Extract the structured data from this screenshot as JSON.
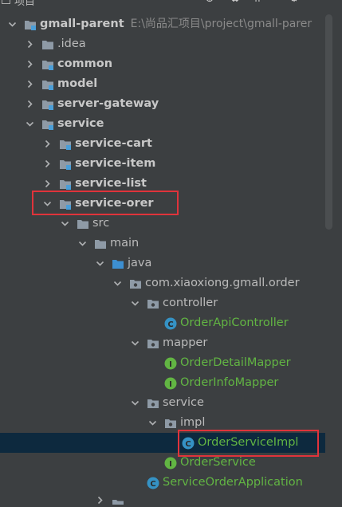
{
  "header": {
    "title": "项目"
  },
  "tree": {
    "rows": [
      {
        "label": "gmall-parent",
        "path": "E:\\尚品汇项目\\project\\gmall-parer"
      },
      {
        "label": ".idea"
      },
      {
        "label": "common"
      },
      {
        "label": "model"
      },
      {
        "label": "server-gateway"
      },
      {
        "label": "service"
      },
      {
        "label": "service-cart"
      },
      {
        "label": "service-item"
      },
      {
        "label": "service-list"
      },
      {
        "label": "service-orer"
      },
      {
        "label": "src"
      },
      {
        "label": "main"
      },
      {
        "label": "java"
      },
      {
        "label": "com.xiaoxiong.gmall.order"
      },
      {
        "label": "controller"
      },
      {
        "label": "OrderApiController",
        "icon_letter": "C"
      },
      {
        "label": "mapper"
      },
      {
        "label": "OrderDetailMapper",
        "icon_letter": "I"
      },
      {
        "label": "OrderInfoMapper",
        "icon_letter": "I"
      },
      {
        "label": "service"
      },
      {
        "label": "impl"
      },
      {
        "label": "OrderServiceImpl",
        "icon_letter": "C"
      },
      {
        "label": "OrderService",
        "icon_letter": "I"
      },
      {
        "label": "ServiceOrderApplication",
        "icon_letter": "C"
      }
    ]
  },
  "colors": {
    "background": "#3c3f41",
    "selected_row": "#0d293e",
    "highlight_border": "#e0333b",
    "class_label": "#62b543",
    "class_icon": "#3592c4",
    "interface_icon": "#62b543"
  }
}
